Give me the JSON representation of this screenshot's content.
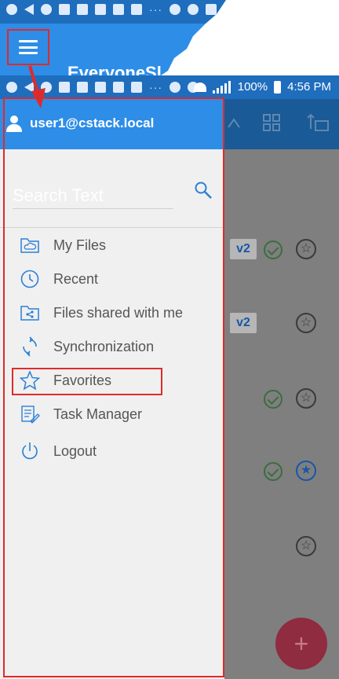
{
  "top_preview": {
    "app_title": "EveryoneSl"
  },
  "status_bar": {
    "battery_percent": "100%",
    "time": "4:56 PM",
    "overflow": "···"
  },
  "drawer": {
    "user_email": "user1@cstack.local",
    "search": {
      "placeholder": "Search Text"
    },
    "items": [
      {
        "label": "My Files",
        "icon": "cloud-folder-icon"
      },
      {
        "label": "Recent",
        "icon": "clock-icon"
      },
      {
        "label": "Files shared with me",
        "icon": "shared-folder-icon"
      },
      {
        "label": "Synchronization",
        "icon": "sync-icon"
      },
      {
        "label": "Favorites",
        "icon": "star-icon"
      },
      {
        "label": "Task Manager",
        "icon": "task-list-icon"
      },
      {
        "label": "Logout",
        "icon": "power-icon"
      }
    ]
  },
  "background_list": {
    "version_badges": [
      "v2",
      "v2"
    ]
  },
  "fab": {
    "label": "+"
  },
  "colors": {
    "primary": "#2d8de7",
    "status_bar": "#1f6dbd",
    "icon_blue": "#2b7fd6",
    "annotation_red": "#e02a2a"
  }
}
